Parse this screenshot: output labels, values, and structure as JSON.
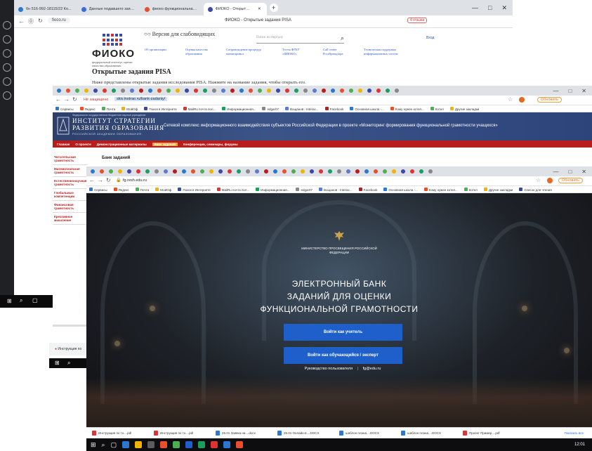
{
  "win1": {
    "tabs": [
      {
        "label": "бн 516-992-18115/22 Ко..."
      },
      {
        "label": "Данные подавшего заяв..."
      },
      {
        "label": "фиоко функциональная..."
      },
      {
        "label": "ФИОКО - Открытые за..."
      }
    ],
    "new_tab": "+",
    "url": "fioco.ru",
    "page_title": "ФИОКО - Открытые задания PISA",
    "badge": "4 отзыва",
    "logo_name": "ФИОКО",
    "logo_sub": "федеральный институт оценки качества образования",
    "low_vision": "Версия для слабовидящих",
    "search_placeholder": "Поиск по порталу",
    "login": "Вход",
    "nav": [
      "Об организации",
      "Оценка качества образования",
      "Сопровождение процедур мониторинга",
      "Тесты ФГБУ «ФИОКО»",
      "Call center Рособрнадзора",
      "Техническая поддержка информационных систем"
    ],
    "heading": "Открытые задания PISA",
    "intro": "Ниже представлены открытые задания исследования PISA. Нажмите на название задания, чтобы открыть его."
  },
  "win2": {
    "security": "Не защищено",
    "url": "skiv.instrao.ru/bank-zadaniy/",
    "bookmarks": [
      "Сервисы",
      "Яндекс",
      "Почта",
      "МойОф",
      "Поиск в Интернете",
      "MailRu почта пол...",
      "Информационная...",
      "edgar07",
      "Вощанов - Interac...",
      "Facebook",
      "Основная школа -...",
      "Кому нужен котел...",
      "Котел",
      "Другие закладки"
    ],
    "inst_small": "Федеральное государственное бюджетное научное учреждение",
    "inst_line1": "ИНСТИТУТ СТРАТЕГИИ",
    "inst_line2": "РАЗВИТИЯ ОБРАЗОВАНИЯ",
    "inst_line3": "РОССИЙСКОЙ АКАДЕМИИ ОБРАЗОВАНИЯ",
    "header_text": "Сетевой комплекс информационного взаимодействия субъектов Российской Федерации в проекте «Мониторинг формирования функциональной грамотности учащихся»",
    "menu": [
      "Главная",
      "О проекте",
      "Демонстрационные материалы",
      "Банк заданий",
      "Конференции, семинары, форумы"
    ],
    "menu_active": "Банк заданий",
    "sidebar": [
      "Читательская грамотность",
      "Математическая грамотность",
      "Естественнонаучная грамотность",
      "Глобальные компетенции",
      "Финансовая грамотность",
      "Креативное мышление"
    ],
    "bank_title": "Банк заданий"
  },
  "win3": {
    "url": "fg.resh.edu.ru",
    "update": "Обновить",
    "bookmarks": [
      "Сервисы",
      "Яндекс",
      "Почта",
      "МойОф",
      "Поиск в Интернете",
      "MailRu почта пол...",
      "Информационная...",
      "edgar07",
      "Вощанов - Interac...",
      "Facebook",
      "Основная школа -...",
      "Кому нужен котел...",
      "Котел",
      "Другие закладки",
      "Список для чтения"
    ],
    "ministry": "МИНИСТЕРСТВО ПРОСВЕЩЕНИЯ РОССИЙСКОЙ ФЕДЕРАЦИИ",
    "heading_l1": "ЭЛЕКТРОННЫЙ БАНК",
    "heading_l2": "ЗАДАНИЙ ДЛЯ ОЦЕНКИ",
    "heading_l3": "ФУНКЦИОНАЛЬНОЙ ГРАМОТНОСТИ",
    "btn_teacher": "Войти как учитель",
    "btn_student": "Войти как обучающийся / эксперт",
    "link_guide": "Руководство пользователя",
    "sep": "|",
    "link_mail": "fg@edu.ru",
    "downloads": [
      "Инструкция по то....pdf",
      "Инструкция по то....pdf",
      "26.01 Заявка на....docx",
      "26.01 Онлайн-в....DOCX",
      "шаблон плана....DOCX",
      "шаблон плана....DOCX",
      "Проект Пример....pdf"
    ],
    "show_all": "Показать все",
    "clock": "12:01"
  },
  "overlay": {
    "download_label": "Инструкция по"
  },
  "colors": {
    "fioko_blue": "#3a4aa8",
    "inst_header": "#2d3f6a",
    "inst_menu": "#b91c1c",
    "bank_button": "#1e5fc9"
  }
}
